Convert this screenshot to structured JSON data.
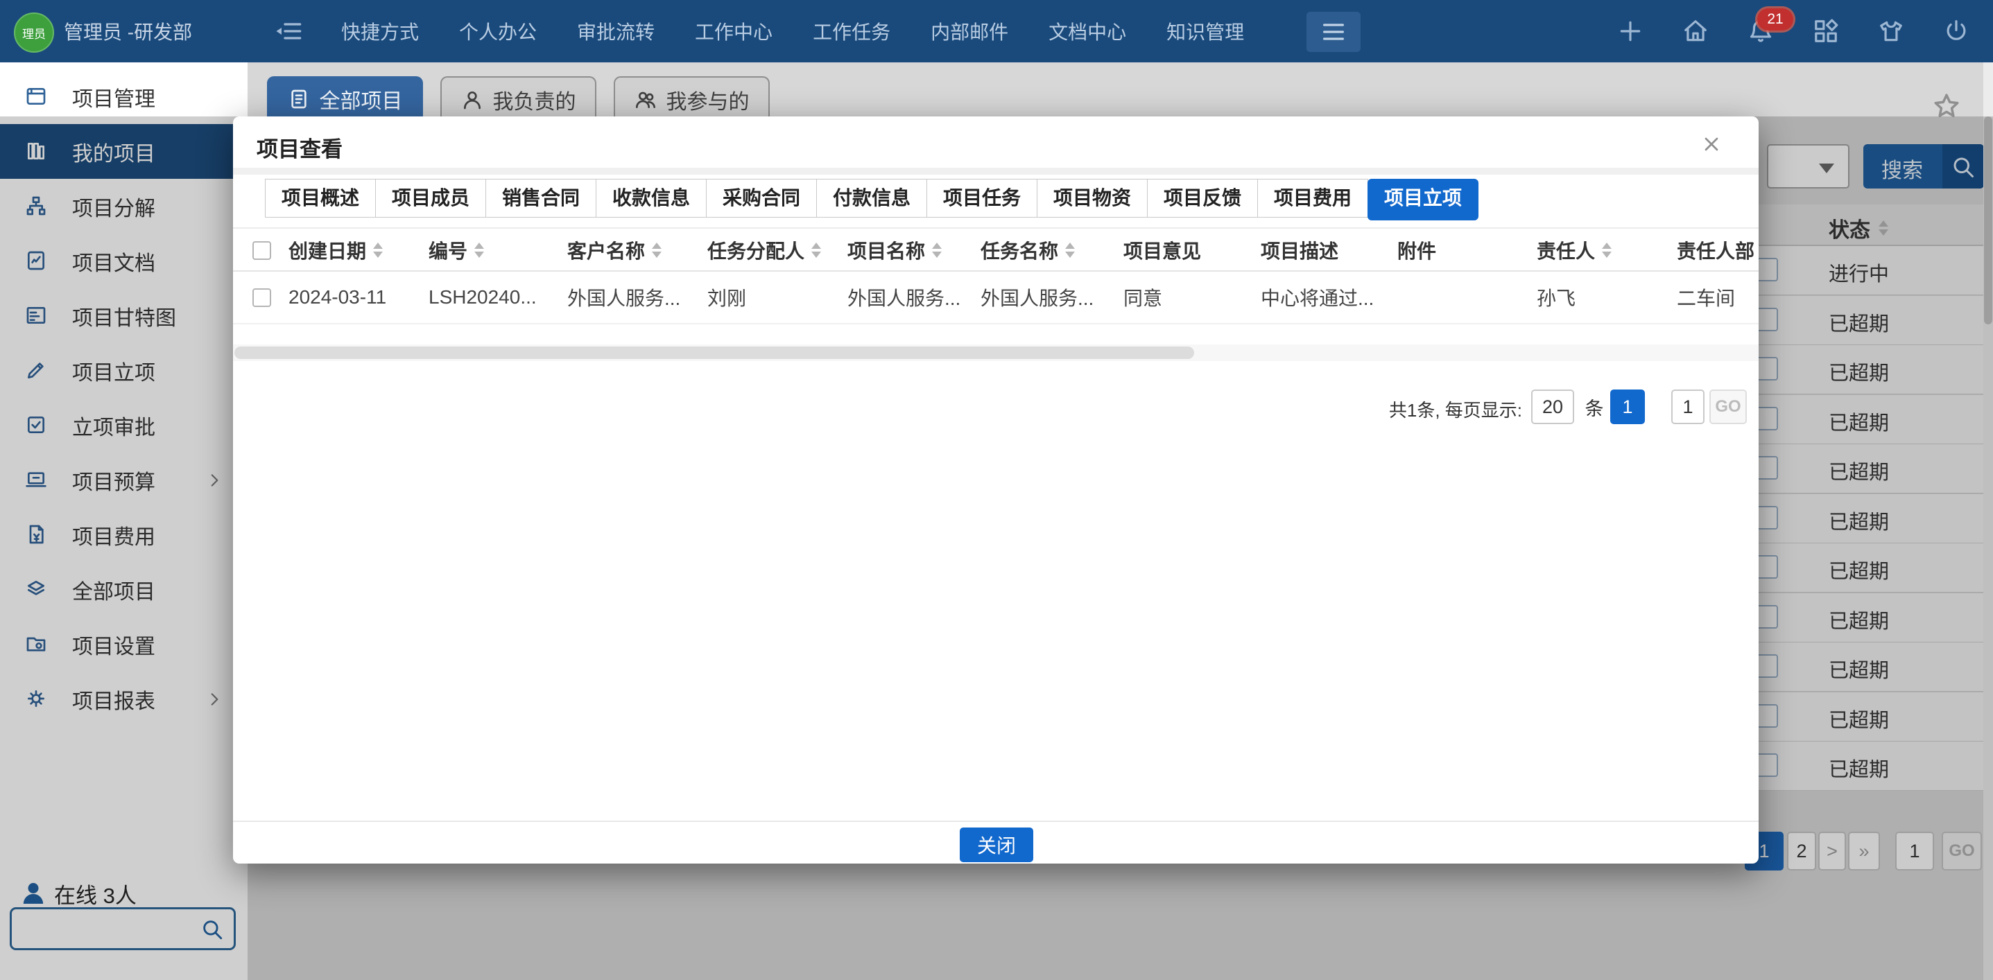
{
  "topbar": {
    "avatar_text": "理员",
    "user_name": "管理员 -研发部",
    "nav": [
      "快捷方式",
      "个人办公",
      "审批流转",
      "工作中心",
      "工作任务",
      "内部邮件",
      "文档中心",
      "知识管理"
    ],
    "notification_count": "21"
  },
  "sidebar": {
    "items": [
      {
        "label": "项目管理"
      },
      {
        "label": "我的项目",
        "selected": true
      },
      {
        "label": "项目分解"
      },
      {
        "label": "项目文档"
      },
      {
        "label": "项目甘特图"
      },
      {
        "label": "项目立项"
      },
      {
        "label": "立项审批"
      },
      {
        "label": "项目预算",
        "has_submenu": true
      },
      {
        "label": "项目费用"
      },
      {
        "label": "全部项目"
      },
      {
        "label": "项目设置"
      },
      {
        "label": "项目报表",
        "has_submenu": true
      }
    ],
    "online_text": "在线 3人"
  },
  "content": {
    "tabs": [
      "全部项目",
      "我负责的",
      "我参与的"
    ],
    "search_button": "搜索",
    "status_header": "状态",
    "status_rows": [
      "进行中",
      "已超期",
      "已超期",
      "已超期",
      "已超期",
      "已超期",
      "已超期",
      "已超期",
      "已超期",
      "已超期",
      "已超期"
    ],
    "pagination": {
      "page1": "1",
      "page2": "2",
      "next": ">",
      "last": "»",
      "jump_value": "1",
      "go": "GO"
    }
  },
  "modal": {
    "title": "项目查看",
    "tabs": [
      "项目概述",
      "项目成员",
      "销售合同",
      "收款信息",
      "采购合同",
      "付款信息",
      "项目任务",
      "项目物资",
      "项目反馈",
      "项目费用",
      "项目立项"
    ],
    "active_tab": "项目立项",
    "table": {
      "headers": [
        "创建日期",
        "编号",
        "客户名称",
        "任务分配人",
        "项目名称",
        "任务名称",
        "项目意见",
        "项目描述",
        "附件",
        "责任人",
        "责任人部"
      ],
      "row": [
        "2024-03-11",
        "LSH20240...",
        "外国人服务...",
        "刘刚",
        "外国人服务...",
        "外国人服务...",
        "同意",
        "中心将通过...",
        "",
        "孙飞",
        "二车间"
      ]
    },
    "pagination": {
      "summary": "共1条, 每页显示:",
      "page_size": "20",
      "unit": "条",
      "current_page": "1",
      "jump_value": "1",
      "go": "GO"
    },
    "close_button": "关闭"
  }
}
